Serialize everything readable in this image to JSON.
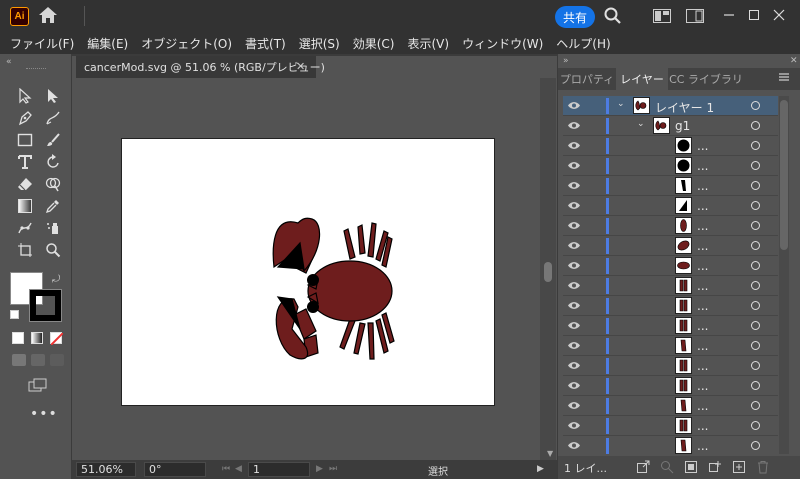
{
  "app": {
    "logo": "Ai",
    "share_label": "共有"
  },
  "menu": [
    "ファイル(F)",
    "編集(E)",
    "オブジェクト(O)",
    "書式(T)",
    "選択(S)",
    "効果(C)",
    "表示(V)",
    "ウィンドウ(W)",
    "ヘルプ(H)"
  ],
  "document": {
    "tab_title": "cancerMod.svg @ 51.06 % (RGB/プレビュー)",
    "close_glyph": "✕"
  },
  "status": {
    "zoom": "51.06%",
    "rotation": "0°",
    "artboard": "1",
    "tool": "選択"
  },
  "panel": {
    "tabs": [
      "プロパティ",
      "レイヤー",
      "CC ライブラリ"
    ],
    "active_tab": "レイヤー",
    "layer_top": "レイヤー 1",
    "group": "g1",
    "ellipsis": "...",
    "footer_count": "1 レイ..."
  },
  "colors": {
    "accent": "#1473e6",
    "crab_fill": "#6e1d1d",
    "layer_bar": "#4d7ce3"
  },
  "icons": [
    "home-icon",
    "search-icon",
    "selection-icon",
    "direct-selection-icon",
    "pen-icon",
    "brush-icon",
    "rectangle-icon",
    "type-icon",
    "rotate-icon",
    "eraser-icon",
    "eyedropper-icon",
    "zoom-icon",
    "eye-icon"
  ]
}
